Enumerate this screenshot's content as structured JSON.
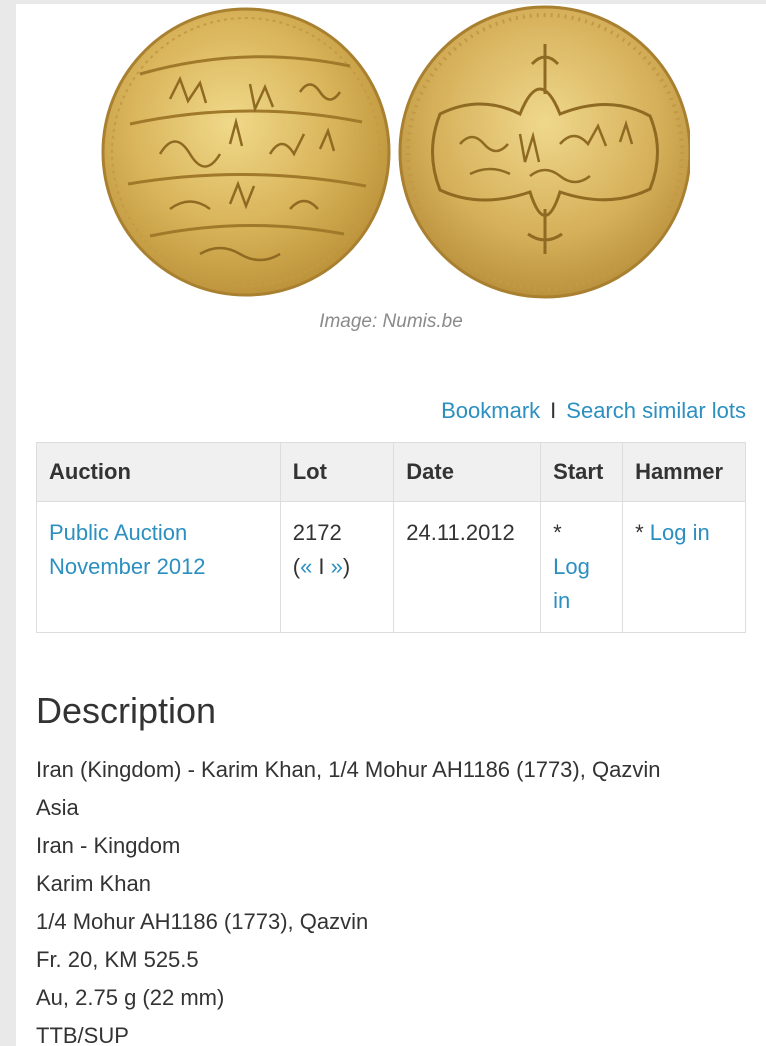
{
  "image": {
    "alt": "Karim Khan 1/4 Mohur gold coin, obverse and reverse",
    "caption": "Image: Numis.be"
  },
  "actions": {
    "bookmark": "Bookmark",
    "separator": "I",
    "search_similar": "Search similar lots"
  },
  "table": {
    "headers": [
      "Auction",
      "Lot",
      "Date",
      "Start",
      "Hammer"
    ],
    "row": {
      "auction": "Public Auction November 2012",
      "lot_number": "2172",
      "lot_nav_open": "(",
      "lot_prev": "«",
      "lot_sep": " I ",
      "lot_next": "»",
      "lot_nav_close": ")",
      "date": "24.11.2012",
      "start_prefix": "*",
      "start_link": "Log in",
      "hammer_prefix": "*",
      "hammer_link": "Log in"
    }
  },
  "description": {
    "title": "Description",
    "lines": [
      "Iran (Kingdom) - Karim Khan, 1/4 Mohur AH1186 (1773), Qazvin",
      "Asia",
      "Iran - Kingdom",
      "Karim Khan",
      "1/4 Mohur AH1186 (1773), Qazvin",
      "Fr. 20, KM 525.5",
      "Au, 2.75 g (22 mm)",
      "TTB/SUP"
    ]
  },
  "colors": {
    "link": "#2b8fc0",
    "gold": "#d8b65a",
    "header_bg": "#f0f0f0"
  }
}
